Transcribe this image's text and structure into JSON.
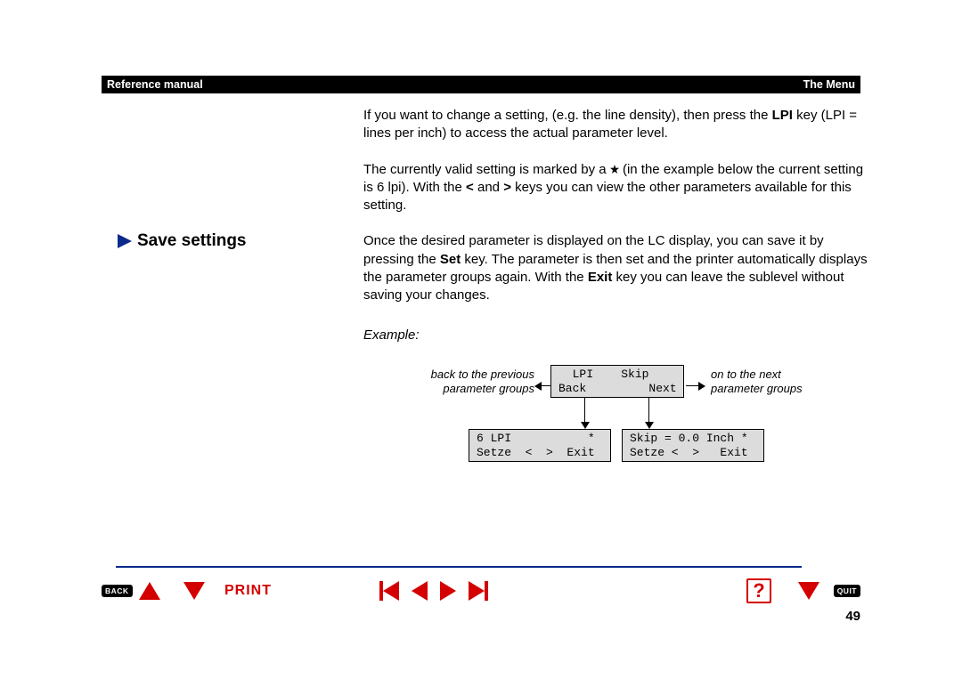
{
  "header": {
    "left": "Reference manual",
    "right": "The Menu"
  },
  "body": {
    "para1_pre": "If you want to change a setting, (e.g. the line density), then press the ",
    "para1_bold": "LPI",
    "para1_post": " key (LPI = lines per inch) to access the actual parameter level.",
    "para2_pre": "The currently valid setting is marked by a ",
    "para2_mid1": " (in the example below the current setting is 6 lpi). With the   ",
    "para2_lt": "<",
    "para2_mid2": " and ",
    "para2_gt": ">",
    "para2_post": "  keys you can view the other parameters available for this setting.",
    "para3_pre": "Once the desired parameter is displayed on the LC display, you can save it by pressing the ",
    "para3_set": "Set",
    "para3_mid": " key. The parameter is then set and the printer automatically displays the parameter groups again. With the ",
    "para3_exit": "Exit",
    "para3_post": " key you can leave the sublevel without saving your changes."
  },
  "heading": "Save settings",
  "example_label": "Example:",
  "diagram": {
    "top_lcd": {
      "row1": "  LPI    Skip",
      "row2": "Back         Next"
    },
    "left_caption_l1": "back to the previous",
    "left_caption_l2": "parameter groups",
    "right_caption_l1": "on to the next",
    "right_caption_l2": "parameter groups",
    "bottom_left_lcd": {
      "row1": "6 LPI           *",
      "row2": "Setze  <  >  Exit"
    },
    "bottom_right_lcd": {
      "row1": "Skip = 0.0 Inch *",
      "row2": "Setze <  >   Exit"
    }
  },
  "footer": {
    "back": "BACK",
    "print": "PRINT",
    "quit": "QUIT",
    "help": "?",
    "page_number": "49"
  }
}
